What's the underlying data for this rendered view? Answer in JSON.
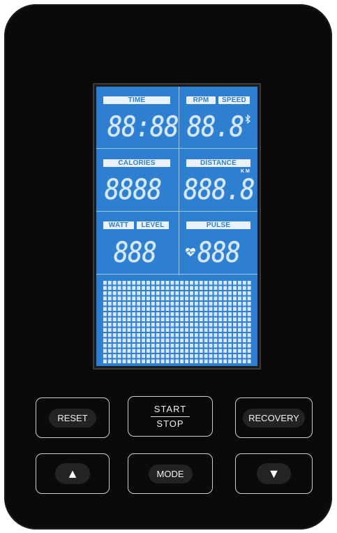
{
  "lcd": {
    "labels": {
      "time": "TIME",
      "rpm": "RPM",
      "speed": "SPEED",
      "calories": "CALORIES",
      "distance": "DISTANCE",
      "watt": "WATT",
      "level": "LEVEL",
      "pulse": "PULSE"
    },
    "readouts": {
      "time": "88:88",
      "rpm_speed": "88.8",
      "calories": "8888",
      "distance": "888.8",
      "watt_level": "888",
      "pulse": "888"
    },
    "distance_unit": "KM",
    "icons": {
      "bluetooth": "bluetooth-icon",
      "heart": "heart-pulse-icon"
    },
    "colors": {
      "lcd_background": "#2f7fd0",
      "segment": "#d6e9fb"
    }
  },
  "buttons": {
    "reset": "RESET",
    "start": "START",
    "stop": "STOP",
    "recovery": "RECOVERY",
    "up": "▲",
    "mode": "MODE",
    "down": "▼"
  }
}
